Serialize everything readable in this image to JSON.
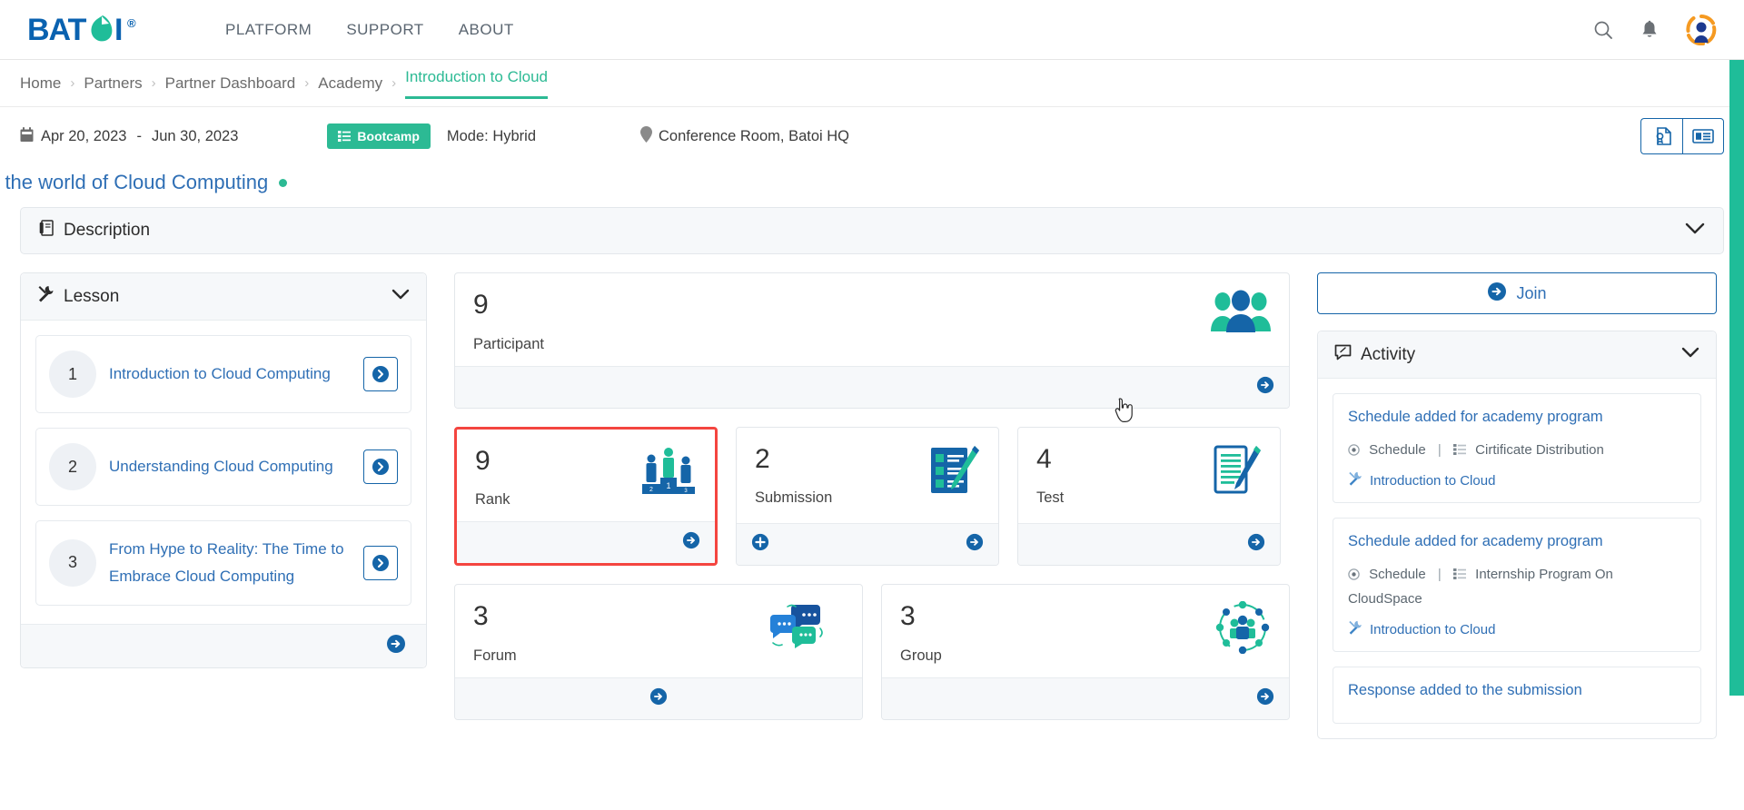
{
  "brand": {
    "name": "BATOI",
    "reg": "®",
    "color": "#0a62b0",
    "accent": "#2cba94"
  },
  "topnav": {
    "links": [
      {
        "label": "PLATFORM"
      },
      {
        "label": "SUPPORT"
      },
      {
        "label": "ABOUT"
      }
    ],
    "icons": [
      {
        "name": "search-icon",
        "label": "Search"
      },
      {
        "name": "bell-icon",
        "label": "Notifications"
      },
      {
        "name": "avatar-icon",
        "label": "User Profile"
      }
    ]
  },
  "breadcrumb": {
    "items": [
      {
        "label": "Home",
        "active": false
      },
      {
        "label": "Partners",
        "active": false
      },
      {
        "label": "Partner Dashboard",
        "active": false
      },
      {
        "label": "Academy",
        "active": false
      },
      {
        "label": "Introduction to Cloud",
        "active": true
      }
    ],
    "separator": "›"
  },
  "schedule": {
    "calendar_icon": "calendar-icon",
    "start_date": "Apr 20, 2023",
    "date_separator": "-",
    "end_date": "Jun 30, 2023",
    "badge": "Bootcamp",
    "badge_color": "#2cba94",
    "mode": "Mode: Hybrid",
    "location_icon": "location-pin-icon",
    "location": "Conference Room, Batoi HQ",
    "actions": [
      {
        "name": "certificate-button"
      },
      {
        "name": "news-card-button"
      }
    ]
  },
  "page_title": {
    "text": "› the world of Cloud Computing",
    "status_dot_color": "#2cba94"
  },
  "description_panel": {
    "title": "Description",
    "icon": "book-icon",
    "chevron": "chevron-down-icon"
  },
  "lesson_panel": {
    "title": "Lesson",
    "icon": "tools-icon",
    "chevron": "chevron-down-icon",
    "lessons": [
      {
        "number": "1",
        "title": "Introduction to Cloud Computing"
      },
      {
        "number": "2",
        "title": "Understanding Cloud Computing"
      },
      {
        "number": "3",
        "title": "From Hype to Reality: The Time to Embrace Cloud Computing"
      }
    ],
    "footer_action": "arrow-right-circle-icon"
  },
  "stats": {
    "participant": {
      "count": "9",
      "label": "Participant",
      "icon": "people-group-icon",
      "has_add": false,
      "highlighted": false
    },
    "cards_row1": [
      {
        "count": "9",
        "label": "Rank",
        "icon": "podium-icon",
        "has_add": false,
        "highlighted": true
      },
      {
        "count": "2",
        "label": "Submission",
        "icon": "clipboard-pen-icon",
        "has_add": true,
        "highlighted": false
      },
      {
        "count": "4",
        "label": "Test",
        "icon": "document-pen-icon",
        "has_add": false,
        "highlighted": false
      }
    ],
    "cards_row2": [
      {
        "count": "3",
        "label": "Forum",
        "icon": "chat-bubbles-icon",
        "has_add": false,
        "highlighted": false,
        "arrow_center": true
      },
      {
        "count": "3",
        "label": "Group",
        "icon": "network-people-icon",
        "has_add": false,
        "highlighted": false,
        "arrow_center": false
      }
    ],
    "highlight_color": "#f4453f"
  },
  "join": {
    "label": "Join",
    "icon": "arrow-right-circle-icon"
  },
  "activity_panel": {
    "title": "Activity",
    "icon": "comment-icon",
    "chevron": "chevron-down-icon",
    "items": [
      {
        "title": "Schedule added for academy program",
        "meta_type_icon": "radio-dot-icon",
        "meta_type": "Schedule",
        "meta_divider": "|",
        "meta_target_icon": "list-icon",
        "meta_target": "Cirtificate Distribution",
        "link_icon": "tools-icon",
        "link": "Introduction to Cloud"
      },
      {
        "title": "Schedule added for academy program",
        "meta_type_icon": "radio-dot-icon",
        "meta_type": "Schedule",
        "meta_divider": "|",
        "meta_target_icon": "list-icon",
        "meta_target": "Internship Program On CloudSpace",
        "link_icon": "tools-icon",
        "link": "Introduction to Cloud"
      },
      {
        "title": "Response added to the submission",
        "meta_type_icon": "",
        "meta_type": "",
        "meta_divider": "",
        "meta_target_icon": "",
        "meta_target": "",
        "link_icon": "",
        "link": ""
      }
    ]
  },
  "scrollbar": {
    "color": "#1fbd99"
  }
}
